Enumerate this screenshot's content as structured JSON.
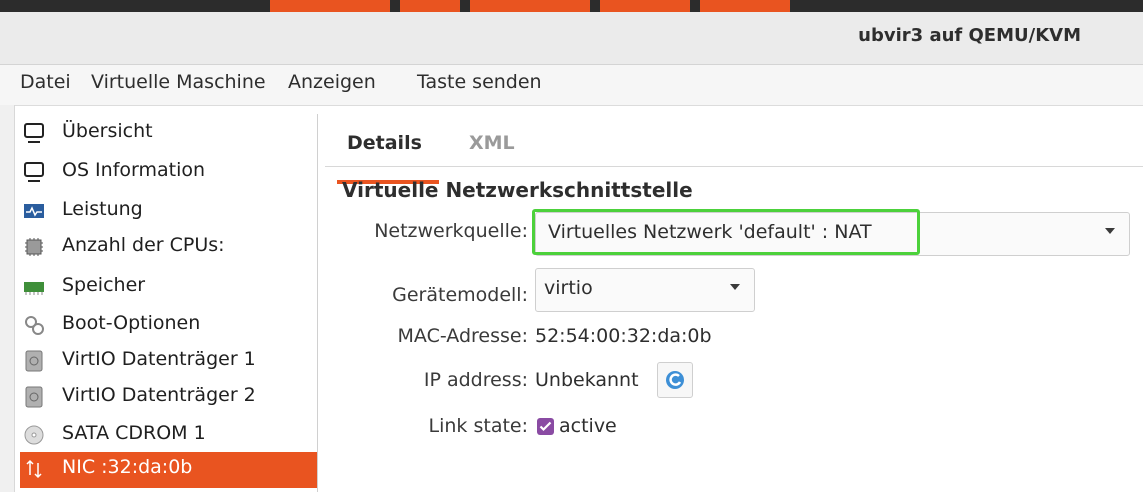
{
  "window": {
    "title": "ubvir3 auf QEMU/KVM"
  },
  "menu": [
    "Datei",
    "Virtuelle Maschine",
    "Anzeigen",
    "Taste senden"
  ],
  "sidebar": {
    "items": [
      {
        "label": "Übersicht",
        "icon": "monitor-icon"
      },
      {
        "label": "OS Information",
        "icon": "monitor-icon"
      },
      {
        "label": "Leistung",
        "icon": "performance-graph-icon"
      },
      {
        "label": "Anzahl der CPUs:",
        "icon": "cpu-chip-icon"
      },
      {
        "label": "Speicher",
        "icon": "memory-module-icon"
      },
      {
        "label": "Boot-Optionen",
        "icon": "gears-icon"
      },
      {
        "label": "VirtIO Datenträger 1",
        "icon": "disk-drive-icon"
      },
      {
        "label": "VirtIO Datenträger 2",
        "icon": "disk-drive-icon"
      },
      {
        "label": "SATA CDROM 1",
        "icon": "cdrom-icon"
      },
      {
        "label": "NIC :32:da:0b",
        "icon": "network-icon",
        "selected": true
      }
    ]
  },
  "tabs": {
    "details": "Details",
    "xml": "XML"
  },
  "section_title": "Virtuelle Netzwerkschnittstelle",
  "fields": {
    "source_label": "Netzwerkquelle:",
    "source_value": "Virtuelles Netzwerk 'default' : NAT",
    "model_label": "Gerätemodell:",
    "model_value": "virtio",
    "mac_label": "MAC-Adresse:",
    "mac_value": "52:54:00:32:da:0b",
    "ip_label": "IP address:",
    "ip_value": "Unbekannt",
    "link_label": "Link state:",
    "link_value": "active"
  },
  "colors": {
    "accent": "#e95420",
    "highlight": "#4cd13b",
    "checkbox": "#8a4ba3"
  }
}
